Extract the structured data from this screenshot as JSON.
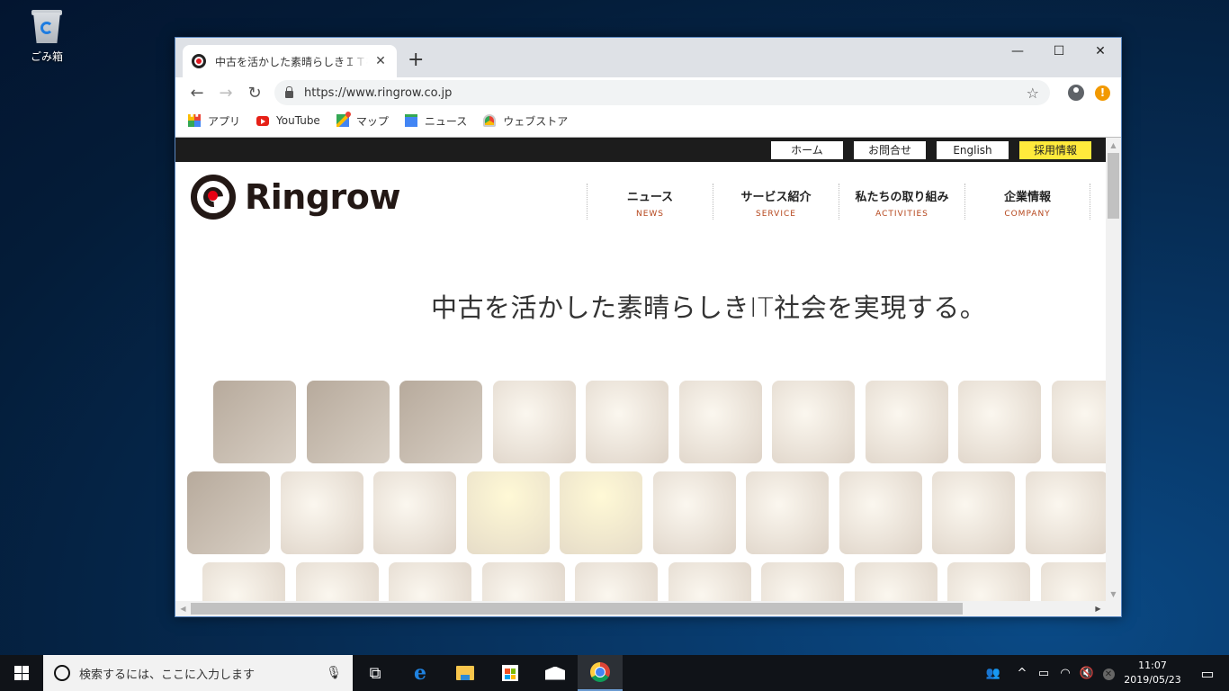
{
  "desktop": {
    "recycle_bin_label": "ごみ箱"
  },
  "browser": {
    "tab": {
      "title": "中古を活かした素晴らしきＩＴ社会を実現する。",
      "close_label": "✕"
    },
    "new_tab_label": "+",
    "window_controls": {
      "minimize": "—",
      "maximize": "☐",
      "close": "✕"
    },
    "nav": {
      "back": "←",
      "forward": "→",
      "reload": "↻"
    },
    "address": {
      "url": "https://www.ringrow.co.jp"
    },
    "star_icon": "☆",
    "alert_icon": "!",
    "bookmarks": [
      {
        "label": "アプリ",
        "icon": "apps-grid-icon"
      },
      {
        "label": "YouTube",
        "icon": "youtube-icon"
      },
      {
        "label": "マップ",
        "icon": "maps-icon"
      },
      {
        "label": "ニュース",
        "icon": "news-icon"
      },
      {
        "label": "ウェブストア",
        "icon": "webstore-icon"
      }
    ]
  },
  "page": {
    "top_links": [
      {
        "label": "ホーム"
      },
      {
        "label": "お問合せ"
      },
      {
        "label": "English"
      },
      {
        "label": "採用情報"
      }
    ],
    "logo_text": "Ringrow",
    "global_nav": [
      {
        "ja": "ニュース",
        "en": "NEWS"
      },
      {
        "ja": "サービス紹介",
        "en": "SERVICE"
      },
      {
        "ja": "私たちの取り組み",
        "en": "ACTIVITIES"
      },
      {
        "ja": "企業情報",
        "en": "COMPANY"
      }
    ],
    "catchphrase": "中古を活かした素晴らしきIT社会を実現する。",
    "accent_color": "#b5451b",
    "recruit_color": "#ffea3c"
  },
  "scrollbars": {
    "up": "▲",
    "down": "▼",
    "left": "◀",
    "right": "▶"
  },
  "taskbar": {
    "search_placeholder": "検索するには、ここに入力します",
    "mic_icon": "🎙",
    "task_view_icon": "⧉",
    "edge_icon": "e",
    "clock_time": "11:07",
    "clock_date": "2019/05/23",
    "tray": {
      "people": "👥",
      "chevron": "^",
      "battery": "▭",
      "wifi": "◠",
      "volume": "🔇",
      "notifications": "▭"
    }
  }
}
